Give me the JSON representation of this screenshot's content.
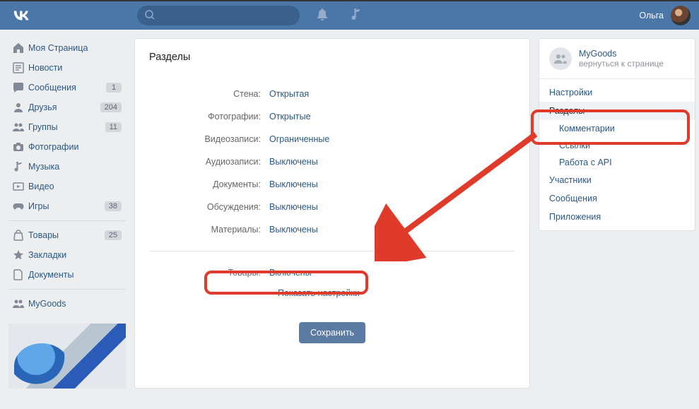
{
  "header": {
    "username": "Ольга"
  },
  "sidebar": {
    "items": [
      {
        "label": "Моя Страница",
        "icon": "home"
      },
      {
        "label": "Новости",
        "icon": "news"
      },
      {
        "label": "Сообщения",
        "icon": "chat",
        "badge": "1"
      },
      {
        "label": "Друзья",
        "icon": "user",
        "badge": "204"
      },
      {
        "label": "Группы",
        "icon": "users",
        "badge": "11"
      },
      {
        "label": "Фотографии",
        "icon": "camera"
      },
      {
        "label": "Музыка",
        "icon": "music"
      },
      {
        "label": "Видео",
        "icon": "video"
      },
      {
        "label": "Игры",
        "icon": "game",
        "badge": "38"
      }
    ],
    "items2": [
      {
        "label": "Товары",
        "icon": "bag",
        "badge": "25"
      },
      {
        "label": "Закладки",
        "icon": "star"
      },
      {
        "label": "Документы",
        "icon": "doc"
      }
    ],
    "items3": [
      {
        "label": "MyGoods",
        "icon": "users"
      }
    ]
  },
  "content": {
    "title": "Разделы",
    "rows": [
      {
        "label": "Стена:",
        "value": "Открытая"
      },
      {
        "label": "Фотографии:",
        "value": "Открытые"
      },
      {
        "label": "Видеозаписи:",
        "value": "Ограниченные"
      },
      {
        "label": "Аудиозаписи:",
        "value": "Выключены"
      },
      {
        "label": "Документы:",
        "value": "Выключены"
      },
      {
        "label": "Обсуждения:",
        "value": "Выключены"
      },
      {
        "label": "Материалы:",
        "value": "Выключены"
      }
    ],
    "goods_row": {
      "label": "Товары:",
      "value": "Включены"
    },
    "show_settings": "Показать настройки",
    "save": "Сохранить"
  },
  "rightcol": {
    "group_name": "MyGoods",
    "back_text": "вернуться к странице",
    "menu": [
      {
        "label": "Настройки"
      },
      {
        "label": "Разделы",
        "sub": [
          {
            "label": "Комментарии"
          },
          {
            "label": "Ссылки"
          },
          {
            "label": "Работа с API"
          }
        ]
      },
      {
        "label": "Участники"
      },
      {
        "label": "Сообщения"
      },
      {
        "label": "Приложения"
      }
    ]
  }
}
